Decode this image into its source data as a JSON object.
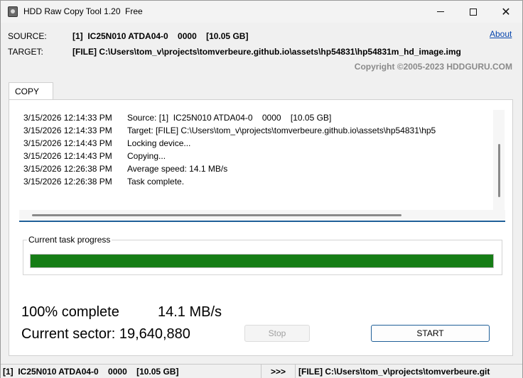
{
  "window": {
    "title": "HDD Raw Copy Tool 1.20",
    "edition": "Free"
  },
  "header": {
    "source_label": "SOURCE:",
    "source_value": "[1]  IC25N010 ATDA04-0    0000    [10.05 GB]",
    "target_label": "TARGET:",
    "target_value": "[FILE] C:\\Users\\tom_v\\projects\\tomverbeure.github.io\\assets\\hp54831\\hp54831m_hd_image.img",
    "about_link": "About",
    "copyright": "Copyright ©2005-2023 HDDGURU.COM"
  },
  "tabs": [
    {
      "label": "COPY",
      "active": true
    }
  ],
  "log": [
    {
      "timestamp": "3/15/2026 12:14:33 PM",
      "message": "Source: [1]  IC25N010 ATDA04-0    0000    [10.05 GB]"
    },
    {
      "timestamp": "3/15/2026 12:14:33 PM",
      "message": "Target: [FILE] C:\\Users\\tom_v\\projects\\tomverbeure.github.io\\assets\\hp54831\\hp5"
    },
    {
      "timestamp": "3/15/2026 12:14:43 PM",
      "message": "Locking device..."
    },
    {
      "timestamp": "3/15/2026 12:14:43 PM",
      "message": "Copying..."
    },
    {
      "timestamp": "3/15/2026 12:26:38 PM",
      "message": "Average speed: 14.1 MB/s"
    },
    {
      "timestamp": "3/15/2026 12:26:38 PM",
      "message": "Task complete."
    }
  ],
  "progress": {
    "label": "Current task progress",
    "percent": 100,
    "fill_color": "#167d16"
  },
  "stats": {
    "complete_text": "100% complete",
    "speed_text": "14.1 MB/s",
    "sector_text": "Current sector: 19,640,880"
  },
  "buttons": {
    "stop_label": "Stop",
    "start_label": "START"
  },
  "statusbar": {
    "source": "[1]  IC25N010 ATDA04-0    0000    [10.05 GB]",
    "arrow": ">>>",
    "target": "[FILE] C:\\Users\\tom_v\\projects\\tomverbeure.git"
  },
  "colors": {
    "accent": "#1f5f98",
    "link": "#0645ad",
    "progress": "#167d16"
  }
}
